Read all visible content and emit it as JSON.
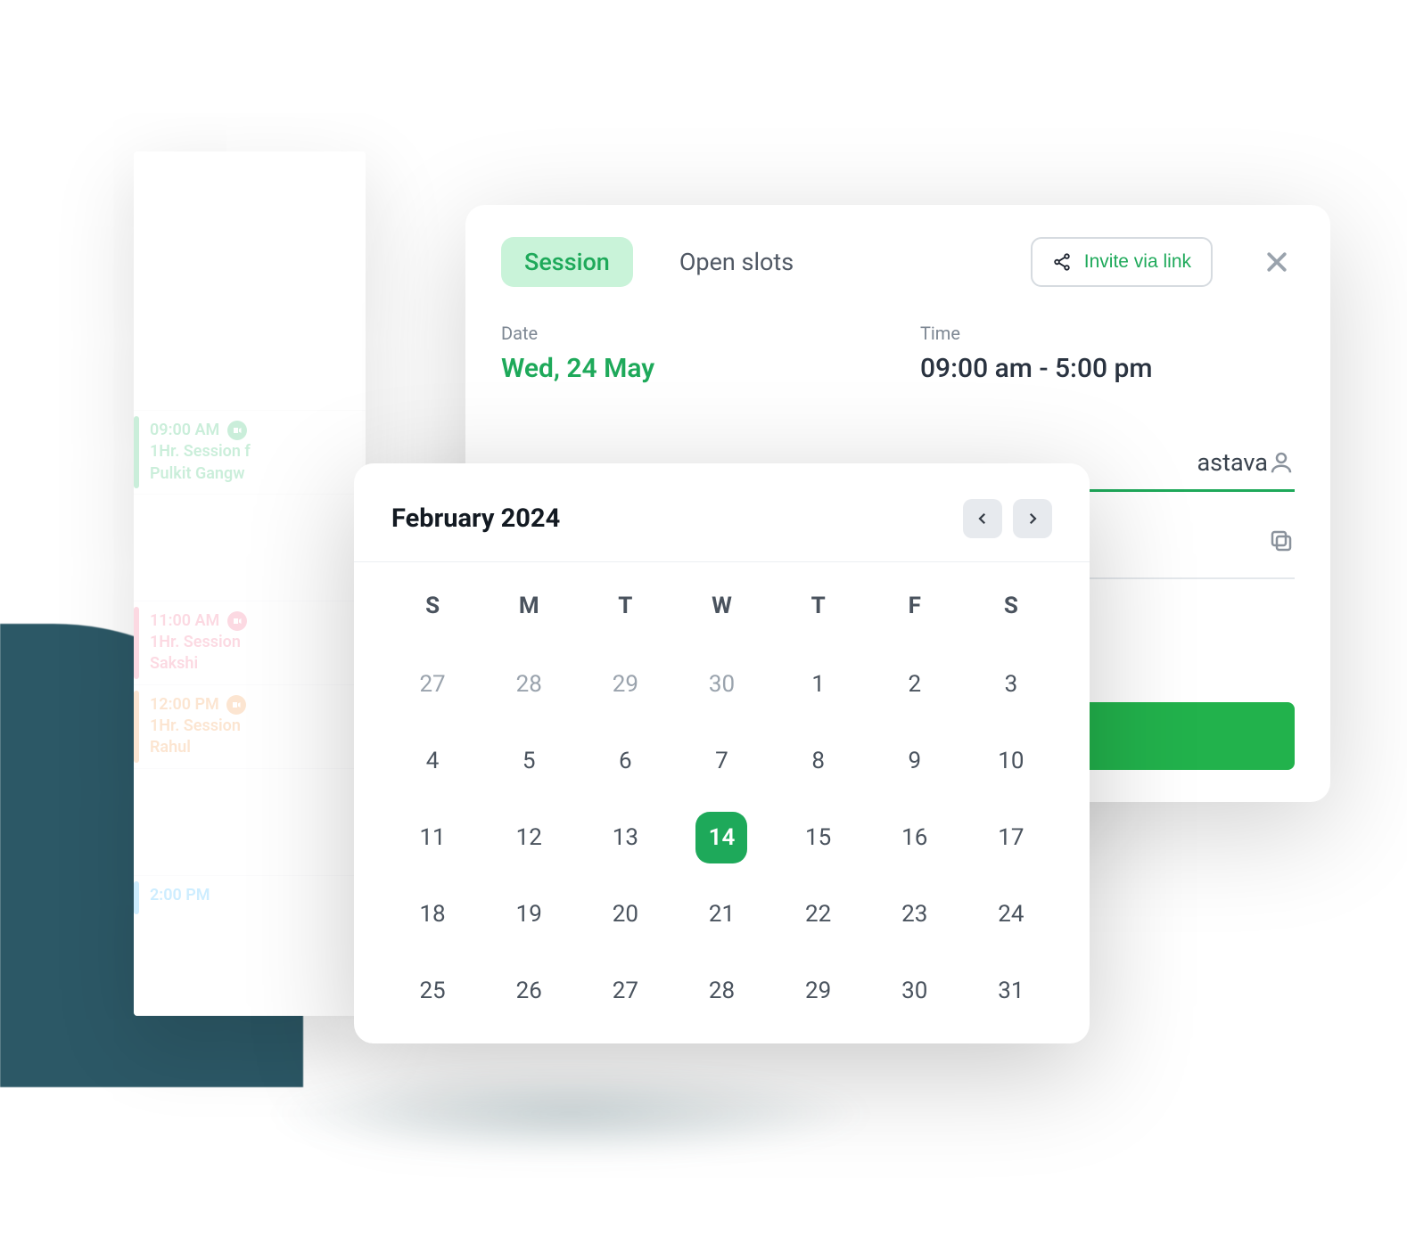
{
  "agenda": {
    "slots": [
      {
        "time": "09:00 AM",
        "title": "1Hr. Session f",
        "subtitle": "Pulkit Gangw",
        "color": "green"
      },
      {
        "time": "11:00 AM",
        "title": "1Hr. Session",
        "subtitle": "Sakshi",
        "color": "pink"
      },
      {
        "time": "12:00 PM",
        "title": "1Hr. Session",
        "subtitle": "Rahul",
        "color": "orange"
      },
      {
        "time": "2:00 PM",
        "title": "",
        "subtitle": "",
        "color": "blue"
      }
    ]
  },
  "modal": {
    "tabs": {
      "session": "Session",
      "open_slots": "Open slots"
    },
    "invite_label": "Invite via link",
    "date_label": "Date",
    "date_value": "Wed, 24 May",
    "time_label": "Time",
    "time_value": "09:00 am - 5:00 pm",
    "client_fragment": "astava"
  },
  "picker": {
    "title": "February 2024",
    "dows": [
      "S",
      "M",
      "T",
      "W",
      "T",
      "F",
      "S"
    ],
    "leading": [
      27,
      28,
      29,
      30
    ],
    "days": [
      1,
      2,
      3,
      4,
      5,
      6,
      7,
      8,
      9,
      10,
      11,
      12,
      13,
      14,
      15,
      16,
      17,
      18,
      19,
      20,
      21,
      22,
      23,
      24,
      25,
      26,
      27,
      28,
      29,
      30,
      31
    ],
    "selected": 14
  }
}
